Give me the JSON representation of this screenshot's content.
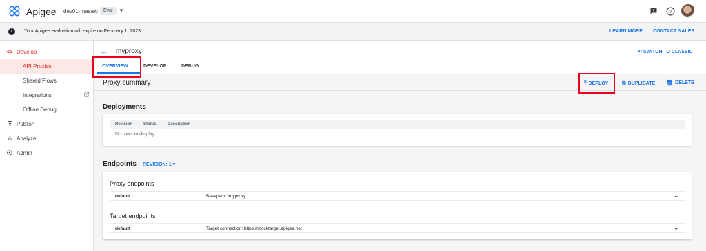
{
  "header": {
    "app_name": "Apigee",
    "org": "dev01-masaki",
    "badge": "Eval",
    "icons": [
      "apigee-logo-icon",
      "feedback-icon",
      "help-icon",
      "avatar"
    ]
  },
  "banner": {
    "message": "Your Apigee evaluation will expire on February 1, 2023.",
    "learn_more": "LEARN MORE",
    "contact_sales": "CONTACT SALES"
  },
  "sidebar": {
    "items": [
      {
        "label": "Develop",
        "icon": "code-icon"
      },
      {
        "label": "API Proxies"
      },
      {
        "label": "Shared Flows"
      },
      {
        "label": "Integrations"
      },
      {
        "label": "Offline Debug"
      },
      {
        "label": "Publish",
        "icon": "publish-icon"
      },
      {
        "label": "Analyze",
        "icon": "analyze-icon"
      },
      {
        "label": "Admin",
        "icon": "admin-icon"
      }
    ]
  },
  "main": {
    "title": "myproxy",
    "switch_classic": "SWITCH TO CLASSIC",
    "tabs": [
      {
        "label": "OVERVIEW",
        "active": true
      },
      {
        "label": "DEVELOP"
      },
      {
        "label": "DEBUG"
      }
    ],
    "summary_title": "Proxy summary",
    "actions": {
      "deploy": "DEPLOY",
      "duplicate": "DUPLICATE",
      "delete": "DELETE"
    },
    "deployments": {
      "title": "Deployments",
      "columns": [
        "Revision",
        "Status",
        "Description"
      ],
      "empty": "No rows to display"
    },
    "endpoints": {
      "title": "Endpoints",
      "revision": "REVISION: 1",
      "proxy_title": "Proxy endpoints",
      "proxy_rows": [
        {
          "name": "default",
          "detail": "Basepath: /myproxy"
        }
      ],
      "target_title": "Target endpoints",
      "target_rows": [
        {
          "name": "default",
          "detail": "Target connection: https://mocktarget.apigee.net"
        }
      ]
    }
  },
  "colors": {
    "accent": "#1a73e8",
    "develop_red": "#d93025",
    "highlight_box": "#e8001c"
  }
}
